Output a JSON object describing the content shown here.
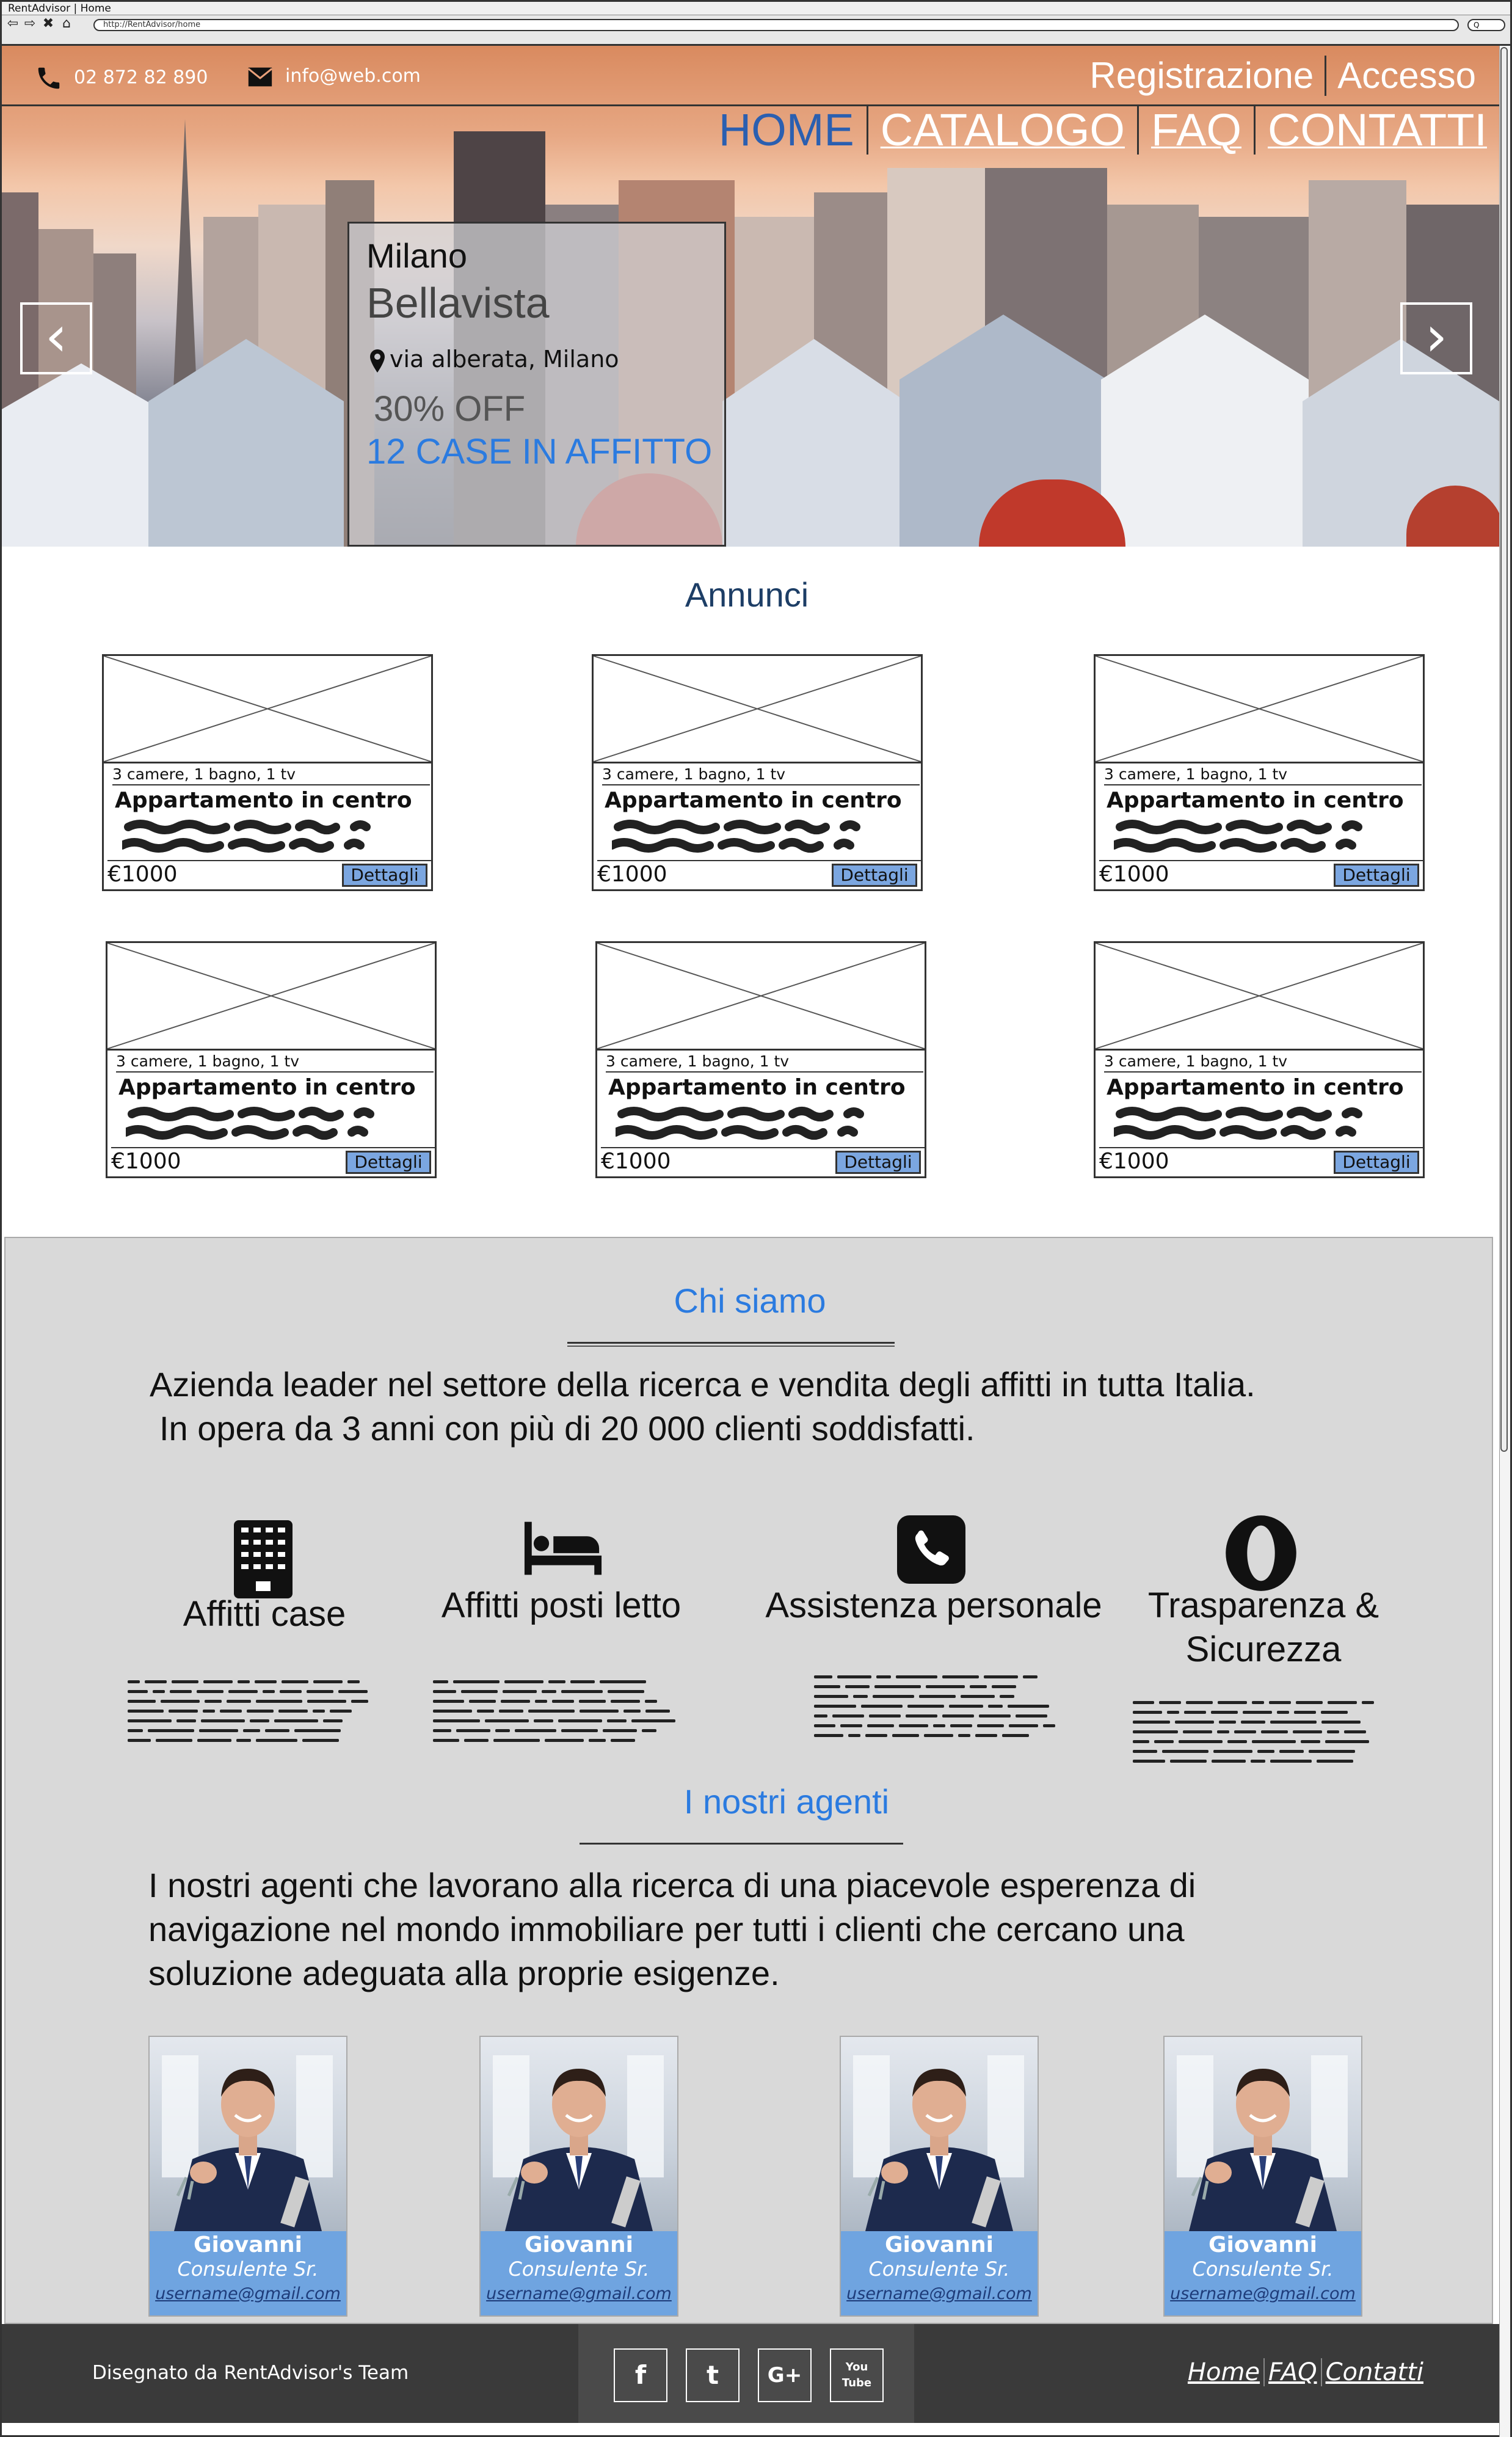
{
  "browser": {
    "window_title": "RentAdvisor | Home",
    "url": "http://RentAdvisor/home",
    "search_label": "Q"
  },
  "header": {
    "phone": "02 872 82 890",
    "email": "info@web.com",
    "auth": [
      "Registrazione",
      "Accesso"
    ],
    "nav": [
      "HOME",
      "CATALOGO",
      "FAQ",
      "CONTATTI"
    ],
    "active_nav": "HOME"
  },
  "hero": {
    "city": "Milano",
    "name": "Bellavista",
    "address": "via alberata, Milano",
    "discount": "30% OFF",
    "count": "12 CASE IN AFFITTO",
    "prev_icon": "chevron-left-icon",
    "next_icon": "chevron-right-icon"
  },
  "annunci": {
    "title": "Annunci",
    "cards": [
      {
        "spec": "3 camere, 1 bagno, 1 tv",
        "title": "Appartamento in centro",
        "price": "€1000",
        "button": "Dettagli"
      },
      {
        "spec": "3 camere, 1 bagno, 1 tv",
        "title": "Appartamento in centro",
        "price": "€1000",
        "button": "Dettagli"
      },
      {
        "spec": "3 camere, 1 bagno, 1 tv",
        "title": "Appartamento in centro",
        "price": "€1000",
        "button": "Dettagli"
      },
      {
        "spec": "3 camere, 1 bagno, 1 tv",
        "title": "Appartamento in centro",
        "price": "€1000",
        "button": "Dettagli"
      },
      {
        "spec": "3 camere, 1 bagno, 1 tv",
        "title": "Appartamento in centro",
        "price": "€1000",
        "button": "Dettagli"
      },
      {
        "spec": "3 camere, 1 bagno, 1 tv",
        "title": "Appartamento in centro",
        "price": "€1000",
        "button": "Dettagli"
      }
    ]
  },
  "chi_siamo": {
    "title": "Chi siamo",
    "line1": "Azienda leader nel settore della ricerca e vendita degli affitti in tutta Italia.",
    "line2": "In opera da 3 anni con più di 20 000 clienti soddisfatti."
  },
  "features": [
    {
      "icon": "building-icon",
      "label": "Affitti case"
    },
    {
      "icon": "bed-icon",
      "label": "Affitti posti letto"
    },
    {
      "icon": "phone-icon",
      "label": "Assistenza personale"
    },
    {
      "icon": "opera-icon",
      "label_line1": "Trasparenza &",
      "label_line2": "Sicurezza"
    }
  ],
  "agenti": {
    "title": "I nostri agenti",
    "line1": "I nostri agenti che lavorano alla ricerca di una piacevole esperenza di",
    "line2": "navigazione nel mondo immobiliare per tutti i clienti che cercano una",
    "line3": "soluzione adeguata alla proprie esigenze.",
    "list": [
      {
        "name": "Giovanni",
        "role": "Consulente Sr.",
        "email": "username@gmail.com"
      },
      {
        "name": "Giovanni",
        "role": "Consulente Sr.",
        "email": "username@gmail.com"
      },
      {
        "name": "Giovanni",
        "role": "Consulente Sr.",
        "email": "username@gmail.com"
      },
      {
        "name": "Giovanni",
        "role": "Consulente Sr.",
        "email": "username@gmail.com"
      }
    ]
  },
  "footer": {
    "credit": "Disegnato da RentAdvisor's Team",
    "social": [
      "f",
      "t",
      "G+",
      "You Tube"
    ],
    "links": [
      "Home",
      "FAQ",
      "Contatti"
    ]
  }
}
